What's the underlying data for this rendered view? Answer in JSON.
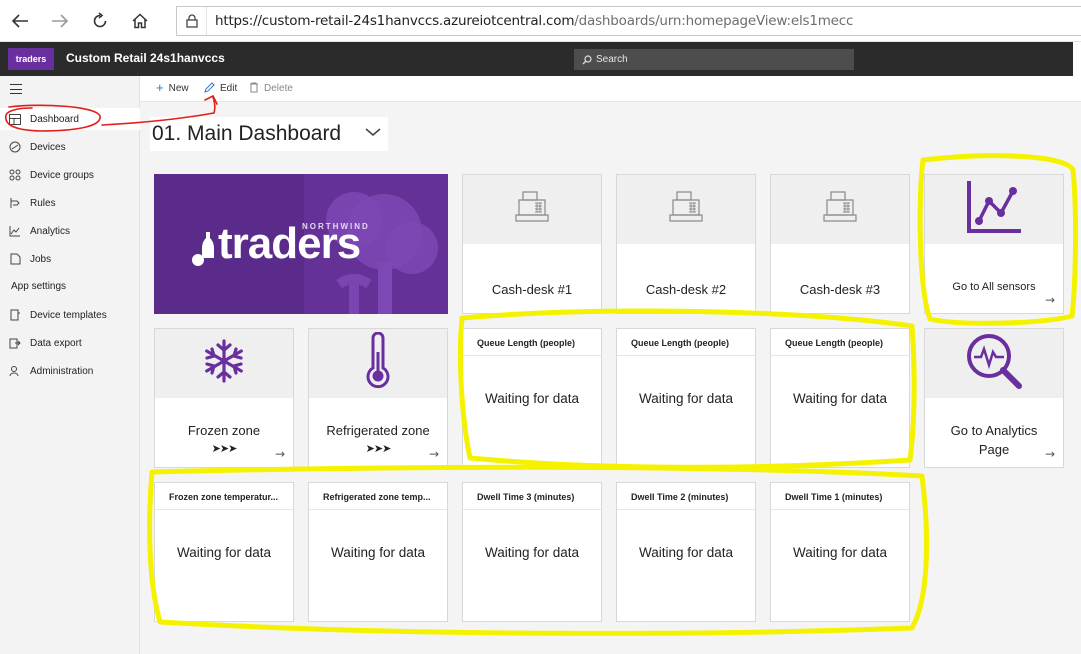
{
  "browser": {
    "url_host": "https://custom-retail-24s1hanvccs.azureiotcentral.com",
    "url_path": "/dashboards/urn:homepageView:els1mecc"
  },
  "app": {
    "title": "Custom Retail 24s1hanvccs",
    "logo_text": "traders",
    "search_placeholder": "Search"
  },
  "commands": {
    "new": "New",
    "edit": "Edit",
    "delete": "Delete"
  },
  "nav": {
    "items": [
      {
        "label": "Dashboard",
        "icon": "dashboard-icon"
      },
      {
        "label": "Devices",
        "icon": "devices-icon"
      },
      {
        "label": "Device groups",
        "icon": "device-groups-icon"
      },
      {
        "label": "Rules",
        "icon": "rules-icon"
      },
      {
        "label": "Analytics",
        "icon": "analytics-icon"
      },
      {
        "label": "Jobs",
        "icon": "jobs-icon"
      }
    ],
    "section_label": "App settings",
    "settings_items": [
      {
        "label": "Device templates",
        "icon": "device-templates-icon"
      },
      {
        "label": "Data export",
        "icon": "data-export-icon"
      },
      {
        "label": "Administration",
        "icon": "administration-icon"
      }
    ]
  },
  "dashboard": {
    "title": "01. Main Dashboard",
    "logo": {
      "small_text": "NORTHWIND",
      "big_text": "traders"
    },
    "cash_desks": [
      "Cash-desk #1",
      "Cash-desk #2",
      "Cash-desk #3"
    ],
    "sensors_link": "Go to All sensors",
    "zones": [
      {
        "label": "Frozen zone",
        "chevrons": "➤➤➤"
      },
      {
        "label": "Refrigerated zone",
        "chevrons": "➤➤➤"
      }
    ],
    "queue_tiles": [
      {
        "title": "Queue Length (people)",
        "value": "Waiting for data"
      },
      {
        "title": "Queue Length (people)",
        "value": "Waiting for data"
      },
      {
        "title": "Queue Length (people)",
        "value": "Waiting for data"
      }
    ],
    "analytics_link": {
      "line1": "Go to Analytics",
      "line2": "Page"
    },
    "bottom_tiles": [
      {
        "title": "Frozen zone temperatur...",
        "value": "Waiting for data"
      },
      {
        "title": "Refrigerated zone temp...",
        "value": "Waiting for data"
      },
      {
        "title": "Dwell Time 3 (minutes)",
        "value": "Waiting for data"
      },
      {
        "title": "Dwell Time 2 (minutes)",
        "value": "Waiting for data"
      },
      {
        "title": "Dwell Time 1 (minutes)",
        "value": "Waiting for data"
      }
    ]
  },
  "colors": {
    "brand_purple": "#6a2f9f",
    "highlight_yellow": "#f5f200",
    "annotation_red": "#e0201b"
  }
}
